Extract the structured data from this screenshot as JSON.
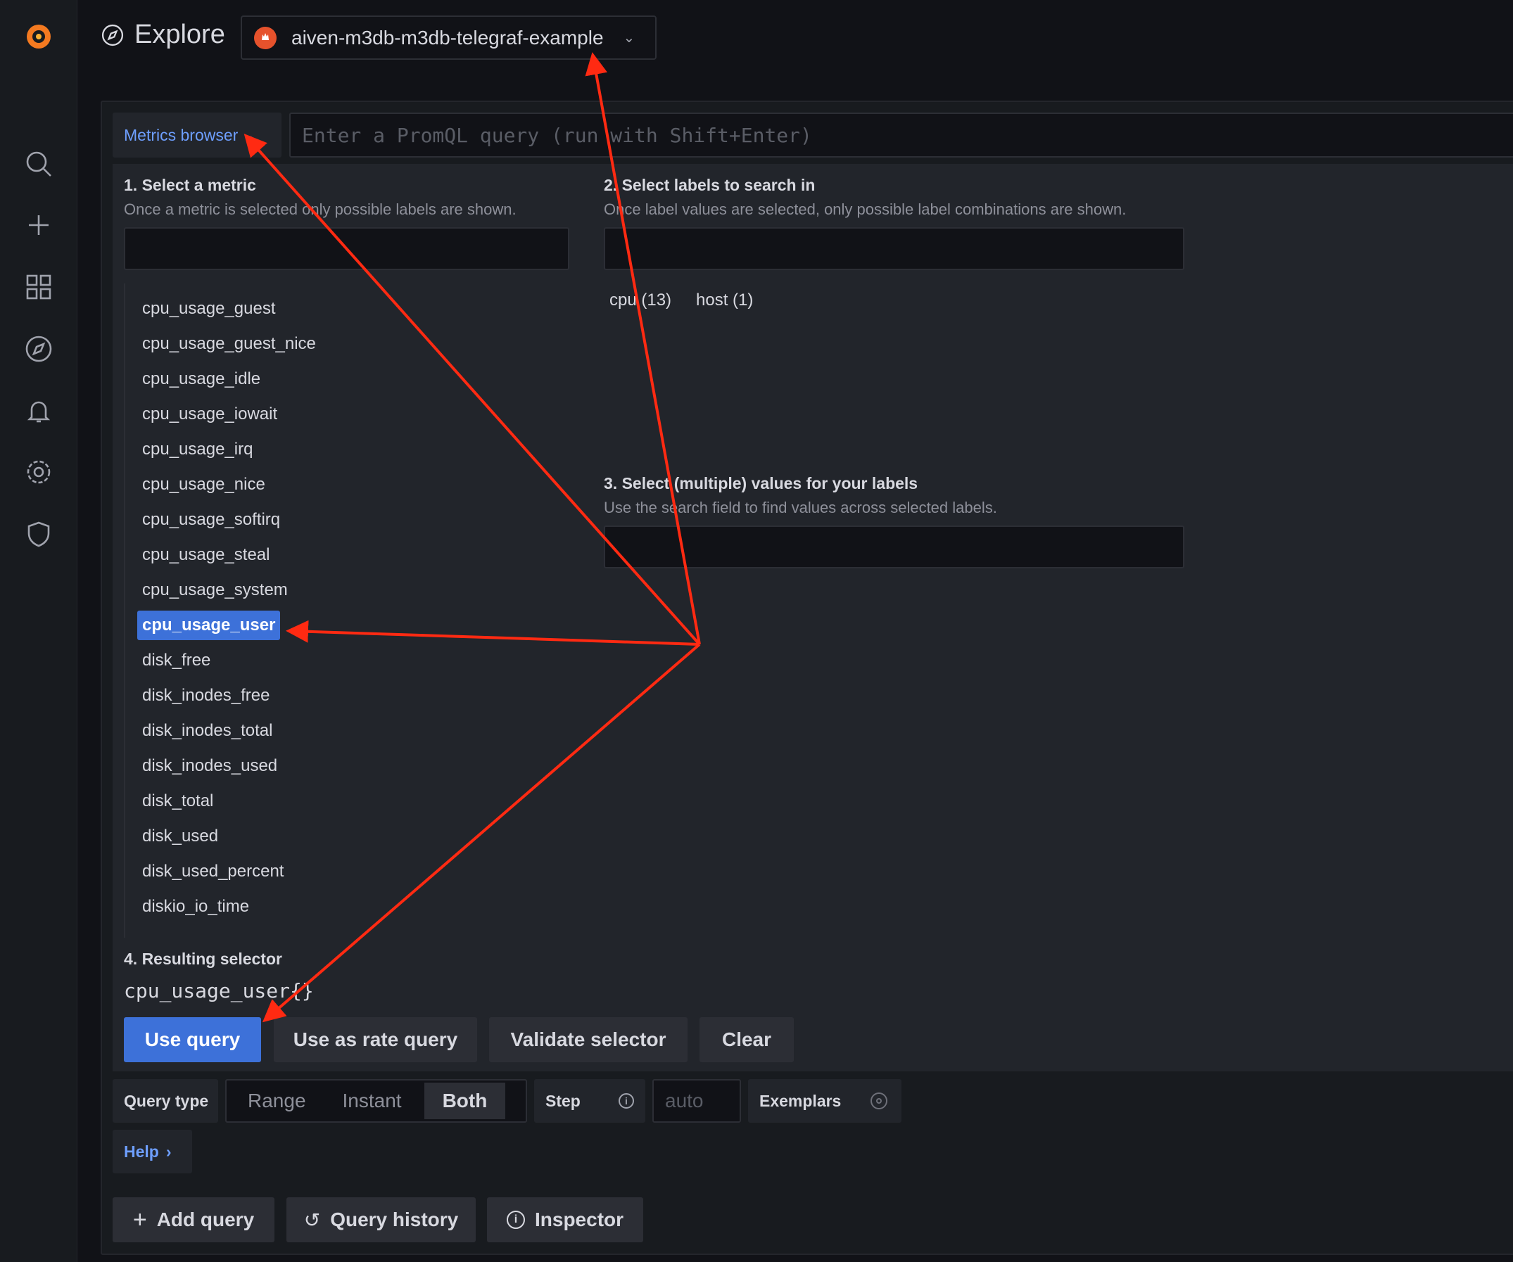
{
  "sidebar": {
    "items": [
      "grafana-logo",
      "search-icon",
      "plus-icon",
      "dashboards-icon",
      "explore-icon",
      "alerting-bell-icon",
      "settings-gear-icon",
      "shield-icon"
    ]
  },
  "header": {
    "title": "Explore",
    "datasource": "aiven-m3db-m3db-telegraf-example"
  },
  "query": {
    "mode_button": "Metrics browser",
    "placeholder": "Enter a PromQL query (run with Shift+Enter)"
  },
  "browser": {
    "step1": {
      "title": "1. Select a metric",
      "subtitle": "Once a metric is selected only possible labels are shown.",
      "search_value": ""
    },
    "metrics": [
      "cpu_usage_guest",
      "cpu_usage_guest_nice",
      "cpu_usage_idle",
      "cpu_usage_iowait",
      "cpu_usage_irq",
      "cpu_usage_nice",
      "cpu_usage_softirq",
      "cpu_usage_steal",
      "cpu_usage_system",
      "cpu_usage_user",
      "disk_free",
      "disk_inodes_free",
      "disk_inodes_total",
      "disk_inodes_used",
      "disk_total",
      "disk_used",
      "disk_used_percent",
      "diskio_io_time"
    ],
    "selected_metric": "cpu_usage_user",
    "step2": {
      "title": "2. Select labels to search in",
      "subtitle": "Once label values are selected, only possible label combinations are shown.",
      "labels": [
        "cpu (13)",
        "host (1)"
      ]
    },
    "step3": {
      "title": "3. Select (multiple) values for your labels",
      "subtitle": "Use the search field to find values across selected labels."
    },
    "step4": {
      "title": "4. Resulting selector",
      "selector": "cpu_usage_user{}"
    },
    "buttons": {
      "use_query": "Use query",
      "use_rate": "Use as rate query",
      "validate": "Validate selector",
      "clear": "Clear"
    }
  },
  "options": {
    "query_type_label": "Query type",
    "types": [
      "Range",
      "Instant",
      "Both"
    ],
    "selected_type": "Both",
    "step_label": "Step",
    "step_value": "auto",
    "exemplars_label": "Exemplars",
    "help": "Help"
  },
  "footer": {
    "add_query": "Add query",
    "query_history": "Query history",
    "inspector": "Inspector"
  },
  "colors": {
    "accent": "#3d71d9",
    "link": "#6e9fff",
    "annotation": "#ff2a12"
  }
}
